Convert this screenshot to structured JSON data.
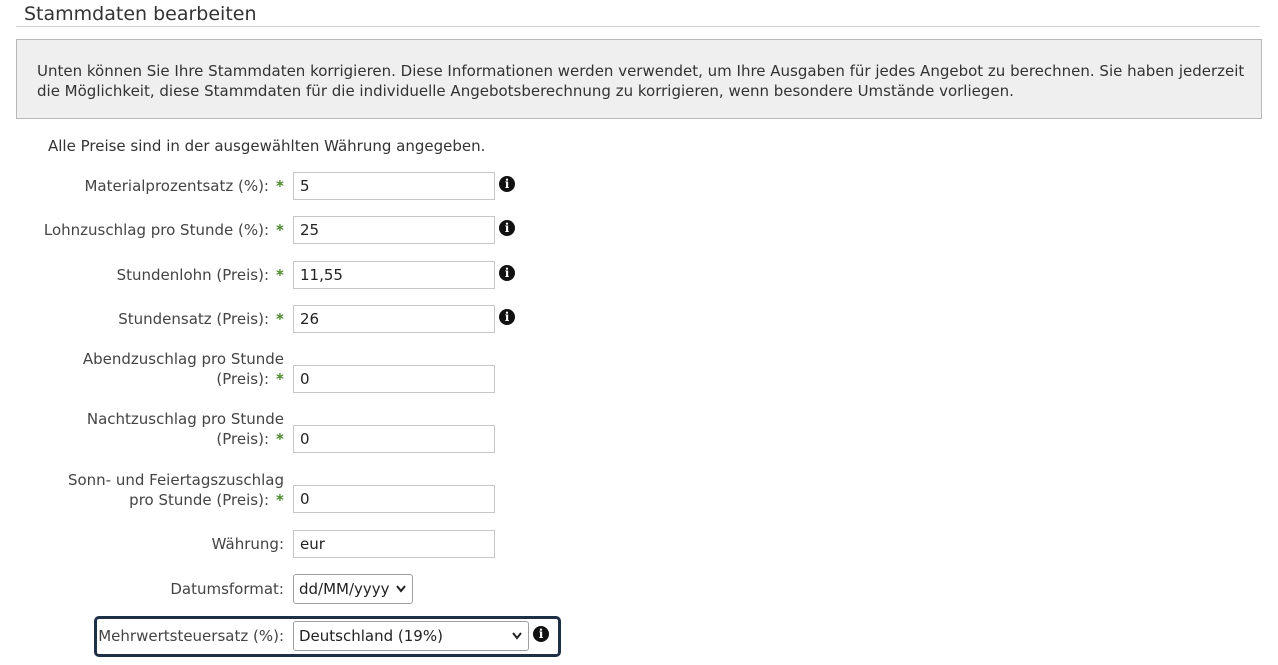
{
  "page": {
    "title": "Stammdaten bearbeiten"
  },
  "info_box": {
    "text": "Unten können Sie Ihre Stammdaten korrigieren. Diese Informationen werden verwendet, um Ihre Ausgaben für jedes Angebot zu berechnen. Sie haben jederzeit die Möglichkeit, diese Stammdaten für die individuelle Angebotsberechnung zu korrigieren, wenn besondere Umstände vorliegen."
  },
  "currency_note": "Alle Preise sind in der ausgewählten Währung angegeben.",
  "required_mark": "*",
  "info_icon_glyph": "i",
  "fields": {
    "material": {
      "label": "Materialprozentsatz (%):",
      "value": "5"
    },
    "lohnzuschlag": {
      "label": "Lohnzuschlag pro Stunde (%):",
      "value": "25"
    },
    "stundenlohn": {
      "label": "Stundenlohn (Preis):",
      "value": "11,55"
    },
    "stundensatz": {
      "label": "Stundensatz (Preis):",
      "value": "26"
    },
    "abend": {
      "label_line1": "Abendzuschlag pro Stunde",
      "label_line2": "(Preis):",
      "value": "0"
    },
    "nacht": {
      "label_line1": "Nachtzuschlag pro Stunde",
      "label_line2": "(Preis):",
      "value": "0"
    },
    "sonn": {
      "label_line1": "Sonn- und Feiertagszuschlag",
      "label_line2": "pro Stunde (Preis):",
      "value": "0"
    },
    "waehrung": {
      "label": "Währung:",
      "value": "eur"
    },
    "datum": {
      "label": "Datumsformat:",
      "value": "dd/MM/yyyy"
    },
    "mwst": {
      "label": "Mehrwertsteuersatz (%):",
      "value": "Deutschland (19%)"
    }
  },
  "icons": {
    "info": "info-circle-icon",
    "dropdown": "chevron-down-icon"
  },
  "colors": {
    "required": "#4a8a2a",
    "highlight_border": "#1d3047",
    "info_box_bg": "#efefef"
  }
}
